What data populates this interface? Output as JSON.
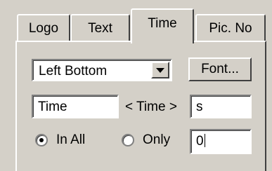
{
  "tabs": [
    {
      "label": "Logo",
      "active": false
    },
    {
      "label": "Text",
      "active": false
    },
    {
      "label": "Time",
      "active": true
    },
    {
      "label": "Pic. No",
      "active": false
    }
  ],
  "position_select": {
    "value": "Left Bottom"
  },
  "font_button": {
    "label": "Font..."
  },
  "prefix_field": {
    "value": "Time"
  },
  "middle_label": "< Time >",
  "suffix_field": {
    "value": "s"
  },
  "scope": {
    "options": [
      {
        "label": "In All",
        "selected": true
      },
      {
        "label": "Only",
        "selected": false
      }
    ],
    "only_value": "0"
  }
}
